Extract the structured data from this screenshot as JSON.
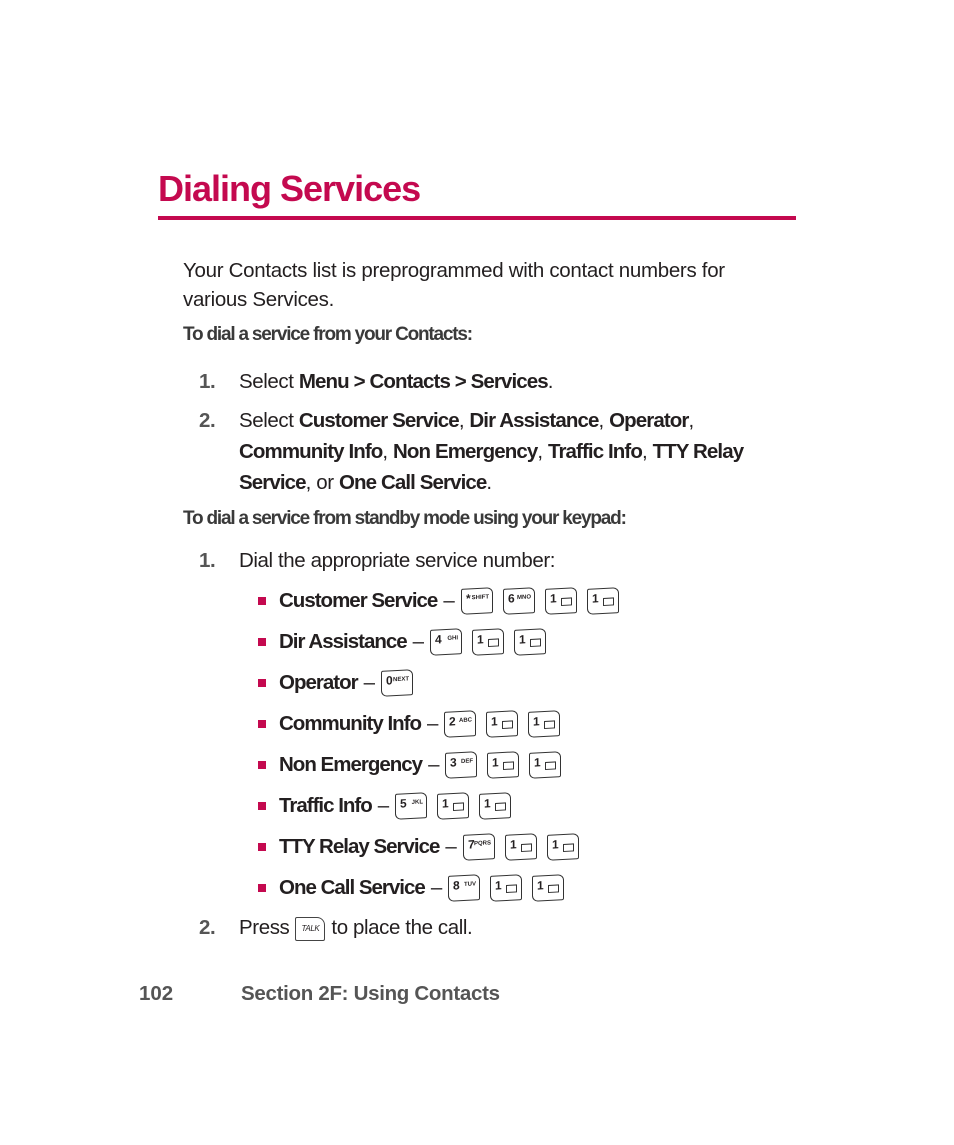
{
  "page": {
    "title": "Dialing Services",
    "intro": "Your Contacts list is preprogrammed with contact numbers for various Services.",
    "section1": {
      "heading": "To dial a service from your Contacts:",
      "steps": [
        {
          "num": "1.",
          "pre": "Select ",
          "bold": "Menu > Contacts > Services",
          "post": "."
        },
        {
          "num": "2.",
          "pre": "Select ",
          "items": [
            "Customer Service",
            "Dir Assistance",
            "Operator",
            "Community Info",
            "Non Emergency",
            "Traffic Info",
            "TTY Relay Service",
            "One Call Service"
          ],
          "joiner_last": ", or ",
          "post": "."
        }
      ]
    },
    "section2": {
      "heading": "To dial a service from standby mode using your keypad:",
      "step1": {
        "num": "1.",
        "text": "Dial the appropriate service number:"
      },
      "services": [
        {
          "name": "Customer Service",
          "keys": [
            {
              "d": "*",
              "l": "SHIFT"
            },
            {
              "d": "6",
              "l": "MNO"
            },
            {
              "d": "1",
              "l": "env"
            },
            {
              "d": "1",
              "l": "env"
            }
          ]
        },
        {
          "name": "Dir Assistance",
          "keys": [
            {
              "d": "4",
              "l": "GHI"
            },
            {
              "d": "1",
              "l": "env"
            },
            {
              "d": "1",
              "l": "env"
            }
          ]
        },
        {
          "name": "Operator",
          "keys": [
            {
              "d": "0",
              "l": "NEXT"
            }
          ]
        },
        {
          "name": "Community Info",
          "keys": [
            {
              "d": "2",
              "l": "ABC"
            },
            {
              "d": "1",
              "l": "env"
            },
            {
              "d": "1",
              "l": "env"
            }
          ]
        },
        {
          "name": "Non Emergency",
          "keys": [
            {
              "d": "3",
              "l": "DEF"
            },
            {
              "d": "1",
              "l": "env"
            },
            {
              "d": "1",
              "l": "env"
            }
          ]
        },
        {
          "name": "Traffic Info",
          "keys": [
            {
              "d": "5",
              "l": "JKL"
            },
            {
              "d": "1",
              "l": "env"
            },
            {
              "d": "1",
              "l": "env"
            }
          ]
        },
        {
          "name": "TTY Relay Service",
          "keys": [
            {
              "d": "7",
              "l": "PQRS"
            },
            {
              "d": "1",
              "l": "env"
            },
            {
              "d": "1",
              "l": "env"
            }
          ]
        },
        {
          "name": "One Call Service",
          "keys": [
            {
              "d": "8",
              "l": "TUV"
            },
            {
              "d": "1",
              "l": "env"
            },
            {
              "d": "1",
              "l": "env"
            }
          ]
        }
      ],
      "dash": "–",
      "step2": {
        "num": "2.",
        "pre": "Press",
        "key": "TALK",
        "post": "to place the call."
      }
    },
    "footer": {
      "page_number": "102",
      "section": "Section 2F: Using Contacts"
    },
    "accent_color": "#c4094f"
  }
}
